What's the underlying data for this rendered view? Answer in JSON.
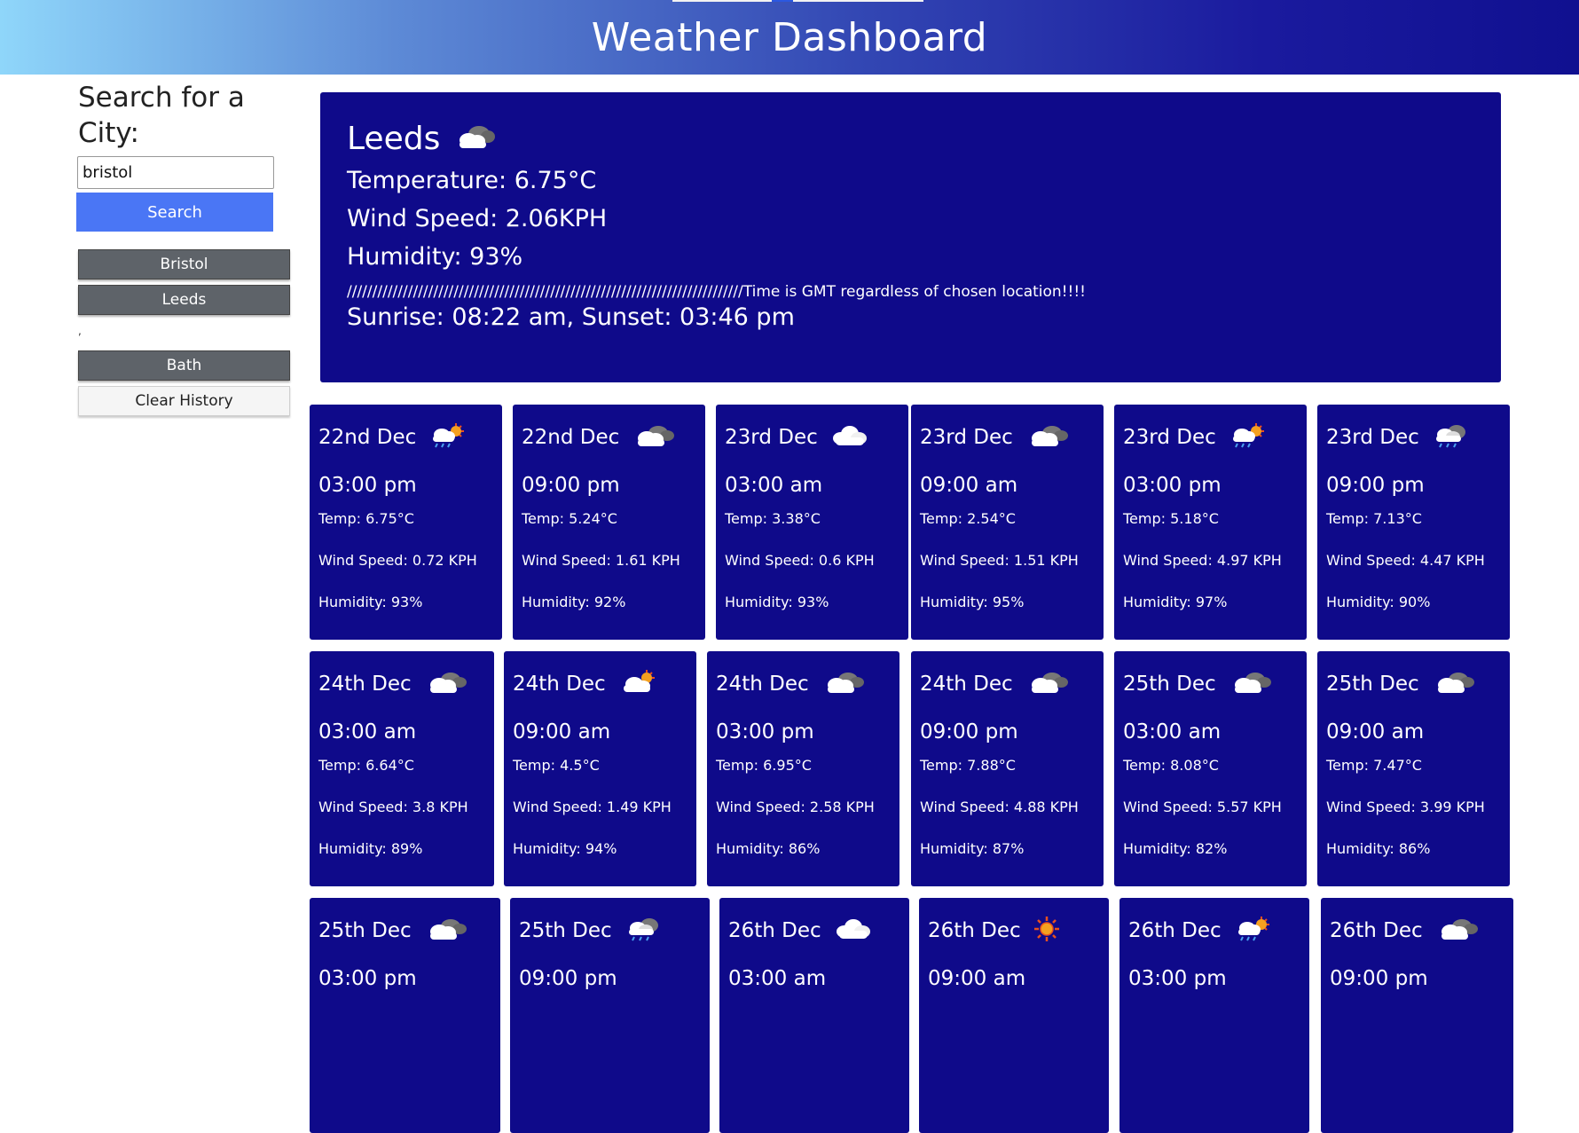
{
  "header": {
    "title": "Weather Dashboard"
  },
  "sidebar": {
    "search_label": "Search for a City:",
    "search_value": "bristol",
    "search_button": "Search",
    "history": [
      "Bristol",
      "Leeds",
      "Bath"
    ],
    "stray_mark": ",",
    "clear_button": "Clear History"
  },
  "current": {
    "city": "Leeds",
    "icon": "cloud-overcast-icon",
    "temperature": "Temperature: 6.75°C",
    "wind": "Wind Speed: 2.06KPH",
    "humidity": "Humidity: 93%",
    "note": "//////////////////////////////////////////////////////////////////////////////Time is GMT regardless of chosen location!!!!",
    "sun": "Sunrise: 08:22 am, Sunset: 03:46 pm"
  },
  "forecast": [
    {
      "date": "22nd Dec",
      "time": "03:00 pm",
      "temp": "Temp: 6.75°C",
      "wind": "Wind Speed: 0.72 KPH",
      "humidity": "Humidity: 93%",
      "icon": "sun-rain-icon"
    },
    {
      "date": "22nd Dec",
      "time": "09:00 pm",
      "temp": "Temp: 5.24°C",
      "wind": "Wind Speed: 1.61 KPH",
      "humidity": "Humidity: 92%",
      "icon": "cloud-overcast-icon"
    },
    {
      "date": "23rd Dec",
      "time": "03:00 am",
      "temp": "Temp: 3.38°C",
      "wind": "Wind Speed: 0.6 KPH",
      "humidity": "Humidity: 93%",
      "icon": "cloud-icon"
    },
    {
      "date": "23rd Dec",
      "time": "09:00 am",
      "temp": "Temp: 2.54°C",
      "wind": "Wind Speed: 1.51 KPH",
      "humidity": "Humidity: 95%",
      "icon": "cloud-overcast-icon"
    },
    {
      "date": "23rd Dec",
      "time": "03:00 pm",
      "temp": "Temp: 5.18°C",
      "wind": "Wind Speed: 4.97 KPH",
      "humidity": "Humidity: 97%",
      "icon": "sun-rain-icon"
    },
    {
      "date": "23rd Dec",
      "time": "09:00 pm",
      "temp": "Temp: 7.13°C",
      "wind": "Wind Speed: 4.47 KPH",
      "humidity": "Humidity: 90%",
      "icon": "cloud-rain-icon"
    },
    {
      "date": "24th Dec",
      "time": "03:00 am",
      "temp": "Temp: 6.64°C",
      "wind": "Wind Speed: 3.8 KPH",
      "humidity": "Humidity: 89%",
      "icon": "cloud-overcast-icon"
    },
    {
      "date": "24th Dec",
      "time": "09:00 am",
      "temp": "Temp: 4.5°C",
      "wind": "Wind Speed: 1.49 KPH",
      "humidity": "Humidity: 94%",
      "icon": "cloud-sun-icon"
    },
    {
      "date": "24th Dec",
      "time": "03:00 pm",
      "temp": "Temp: 6.95°C",
      "wind": "Wind Speed: 2.58 KPH",
      "humidity": "Humidity: 86%",
      "icon": "cloud-overcast-icon"
    },
    {
      "date": "24th Dec",
      "time": "09:00 pm",
      "temp": "Temp: 7.88°C",
      "wind": "Wind Speed: 4.88 KPH",
      "humidity": "Humidity: 87%",
      "icon": "cloud-overcast-icon"
    },
    {
      "date": "25th Dec",
      "time": "03:00 am",
      "temp": "Temp: 8.08°C",
      "wind": "Wind Speed: 5.57 KPH",
      "humidity": "Humidity: 82%",
      "icon": "cloud-overcast-icon"
    },
    {
      "date": "25th Dec",
      "time": "09:00 am",
      "temp": "Temp: 7.47°C",
      "wind": "Wind Speed: 3.99 KPH",
      "humidity": "Humidity: 86%",
      "icon": "cloud-overcast-icon"
    },
    {
      "date": "25th Dec",
      "time": "03:00 pm",
      "icon": "cloud-overcast-icon"
    },
    {
      "date": "25th Dec",
      "time": "09:00 pm",
      "icon": "cloud-rain-icon"
    },
    {
      "date": "26th Dec",
      "time": "03:00 am",
      "icon": "cloud-icon"
    },
    {
      "date": "26th Dec",
      "time": "09:00 am",
      "icon": "sun-icon"
    },
    {
      "date": "26th Dec",
      "time": "03:00 pm",
      "icon": "sun-rain-icon"
    },
    {
      "date": "26th Dec",
      "time": "09:00 pm",
      "icon": "cloud-overcast-icon"
    }
  ]
}
